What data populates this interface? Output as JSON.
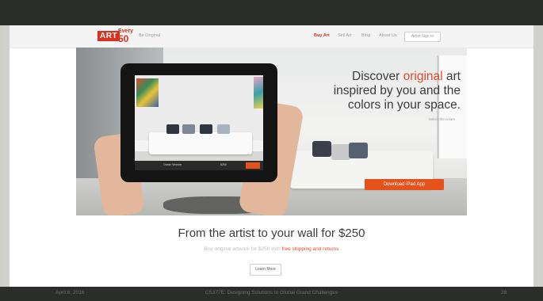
{
  "footer": {
    "date": "April 6, 2016",
    "course": "CS377E: Designing Solutions to Global Grand Challenges",
    "page_number": "28"
  },
  "site": {
    "logo_art": "ART",
    "logo_every_top": "Every",
    "logo_every_big": "50",
    "tagline": "Be Original",
    "nav": {
      "buy_art": "Buy Art",
      "sell_art": "Sell Art",
      "blog": "Blog",
      "about_us": "About Us",
      "artist_sign_in": "Artist Sign In"
    }
  },
  "hero": {
    "headline_line1_pre": "Discover ",
    "headline_line1_highlight": "original",
    "headline_line1_post": " art",
    "headline_line2": "inspired by you and the",
    "headline_line3": "colors in your space.",
    "sub_link": "Select the colors",
    "download_button": "Download iPad App",
    "tablet_bar_label": "Ocean Wonder",
    "tablet_bar_price": "$250"
  },
  "content": {
    "heading": "From the artist to your wall for $250",
    "sub_pre": "Buy original artwork for $250 with ",
    "sub_highlight": "free shipping and returns",
    "learn_more": "Learn More"
  },
  "colors": {
    "brand_red": "#d8311f",
    "cta_orange": "#e5521b",
    "slide_bar": "#2b2d2b"
  }
}
